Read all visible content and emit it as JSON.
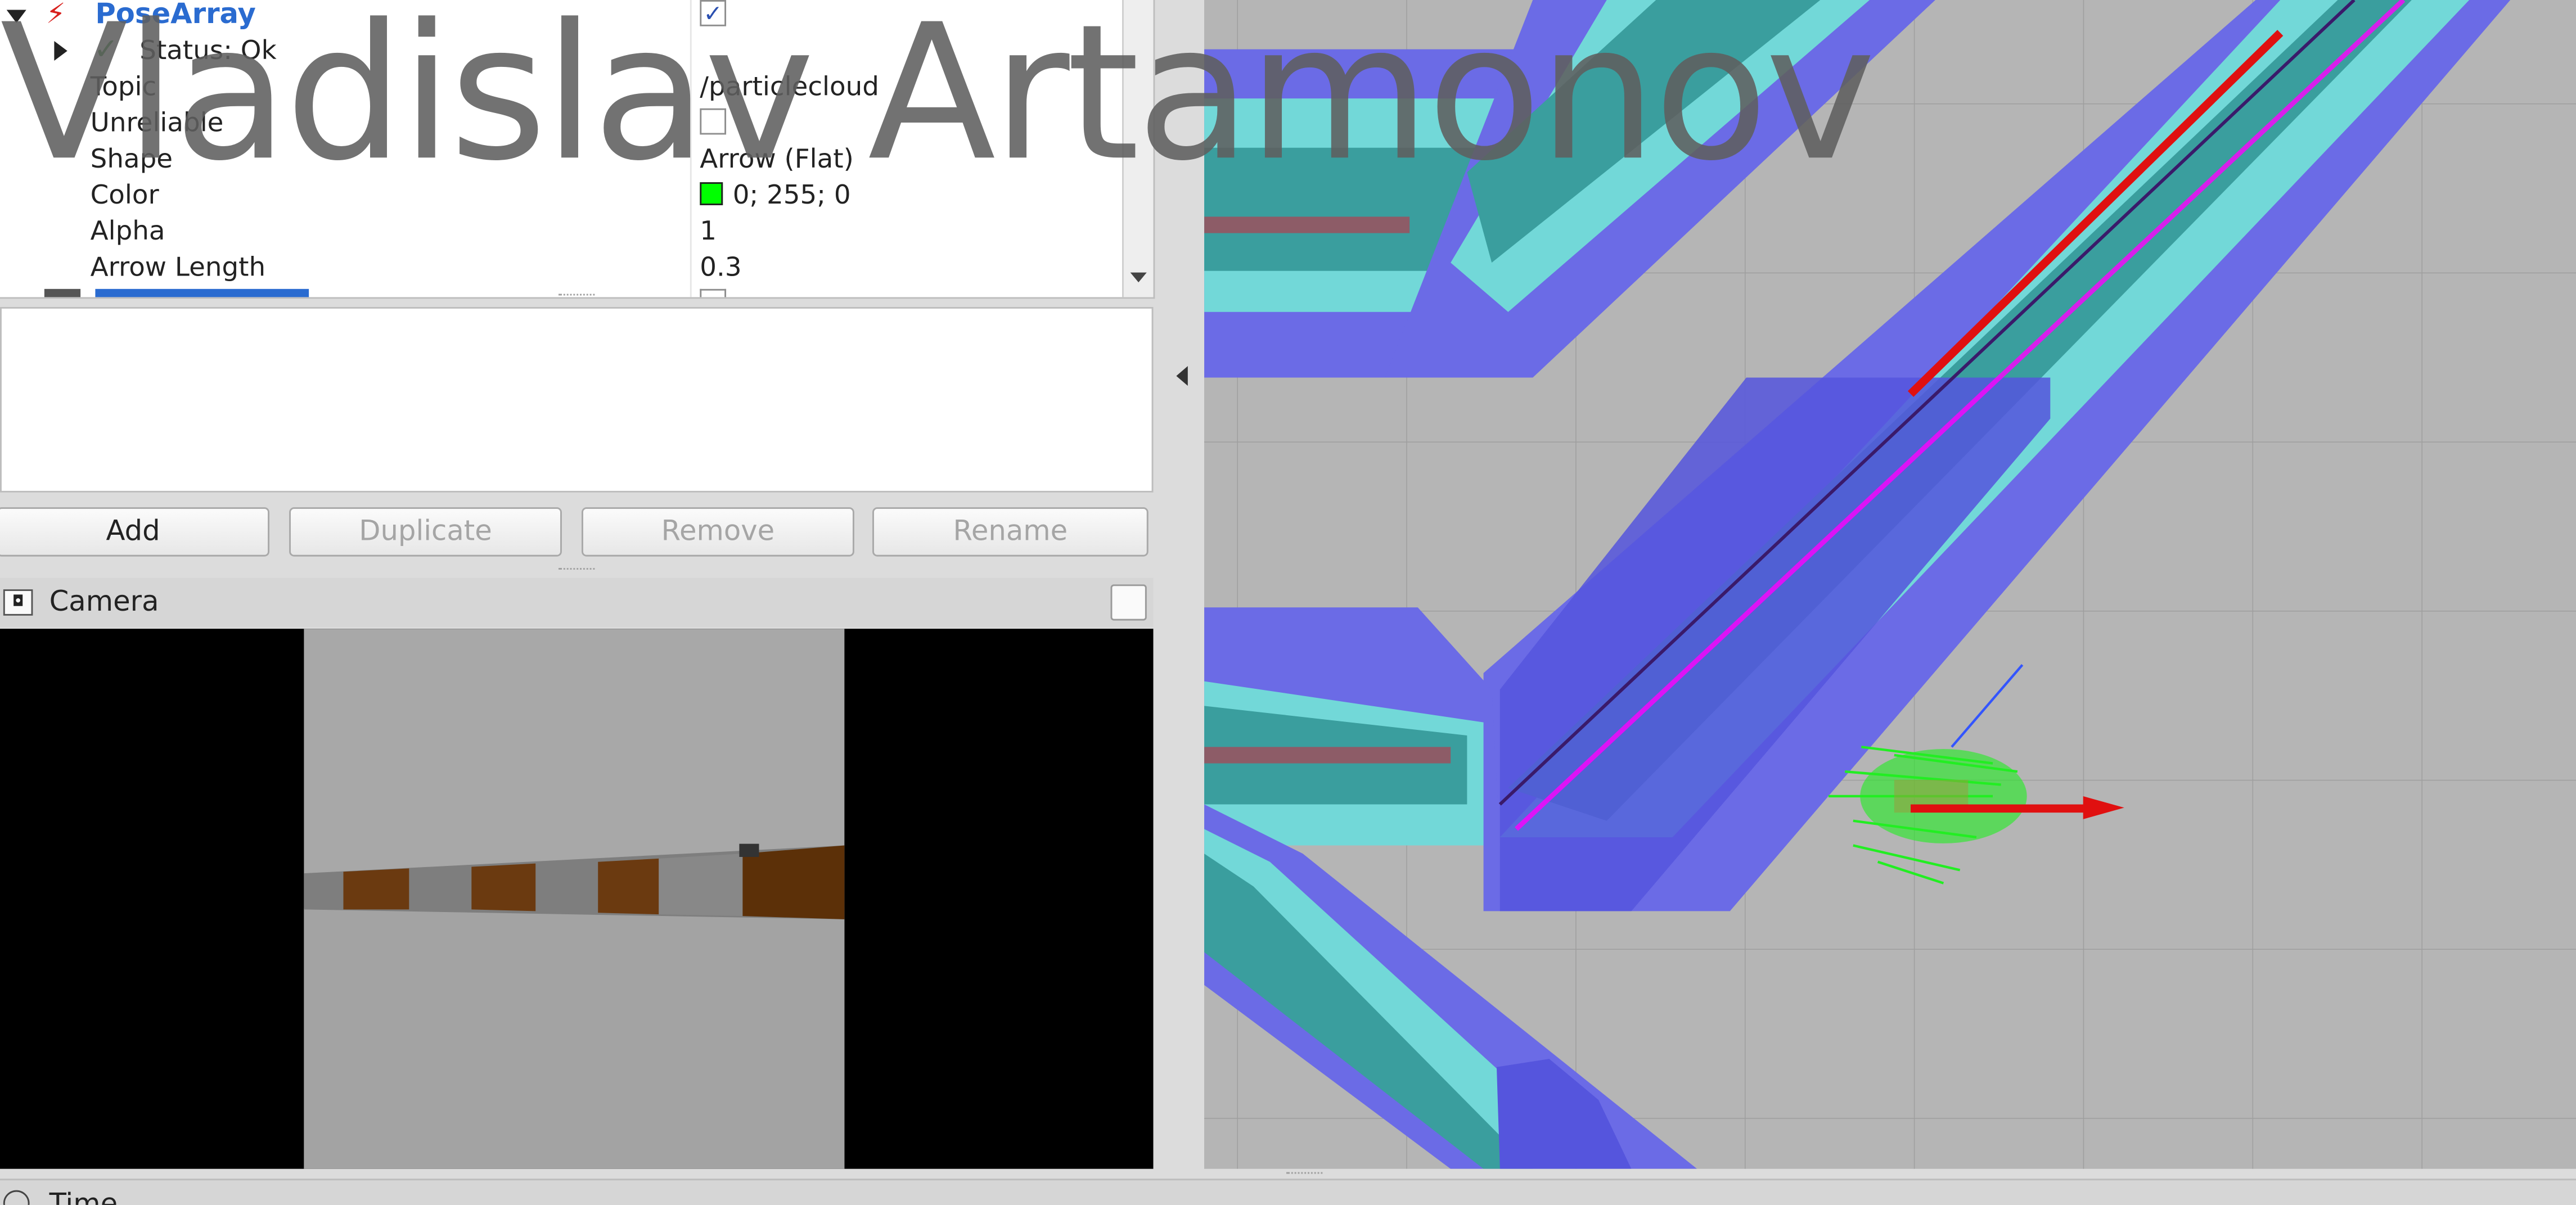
{
  "displays": {
    "header": {
      "label": "PoseArray",
      "checked": "✓"
    },
    "status": {
      "label": "Status: Ok"
    },
    "properties": [
      {
        "label": "Topic",
        "value": "/particlecloud"
      },
      {
        "label": "Unreliable",
        "value": ""
      },
      {
        "label": "Shape",
        "value": "Arrow (Flat)"
      },
      {
        "label": "Color",
        "value": "0; 255; 0",
        "swatch": "#00ff00"
      },
      {
        "label": "Alpha",
        "value": "1"
      },
      {
        "label": "Arrow Length",
        "value": "0.3"
      }
    ]
  },
  "buttons": {
    "add": "Add",
    "duplicate": "Duplicate",
    "remove": "Remove",
    "rename": "Rename"
  },
  "camera_panel": {
    "title": "Camera"
  },
  "time_panel": {
    "title": "Time"
  },
  "watermark": "Vladislav Artamonov",
  "colors": {
    "costmap_inflation": "#6b6be6",
    "costmap_lethal": "#72d8d8",
    "map_obstacle": "#3a9e9e",
    "particles": "#22ee22",
    "global_path": "#ff00ff",
    "robot_heading": "#e01010",
    "grid_background": "#b5b5b5"
  }
}
